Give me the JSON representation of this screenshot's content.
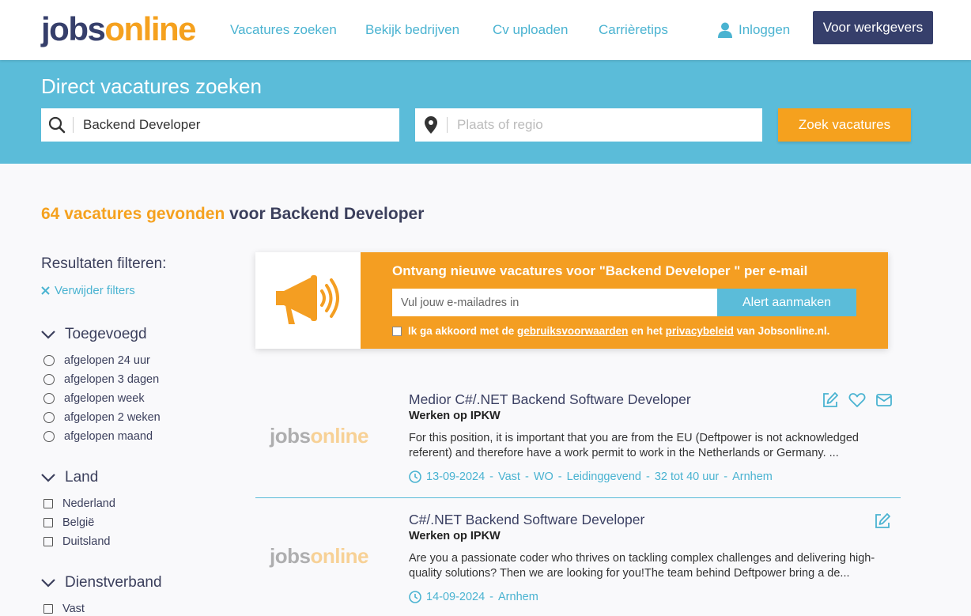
{
  "header": {
    "logo_part1": "jobs",
    "logo_part2": "online",
    "nav": [
      "Vacatures zoeken",
      "Bekijk bedrijven",
      "Cv uploaden",
      "Carrièretips"
    ],
    "login": "Inloggen",
    "employers_button": "Voor werkgevers"
  },
  "search": {
    "title": "Direct vacatures zoeken",
    "keyword_value": "Backend Developer",
    "location_placeholder": "Plaats of regio",
    "button": "Zoek vacatures"
  },
  "results": {
    "count_text": "64 vacatures gevonden",
    "rest_text": " voor Backend Developer"
  },
  "sidebar": {
    "title": "Resultaten filteren:",
    "remove_filters": "Verwijder filters",
    "groups": [
      {
        "name": "Toegevoegd",
        "options": [
          "afgelopen 24 uur",
          "afgelopen 3 dagen",
          "afgelopen week",
          "afgelopen 2 weken",
          "afgelopen maand"
        ]
      },
      {
        "name": "Land",
        "options": [
          "Nederland",
          "België",
          "Duitsland"
        ]
      },
      {
        "name": "Dienstverband",
        "options": [
          "Vast"
        ]
      }
    ]
  },
  "alert": {
    "title": "Ontvang nieuwe vacatures voor \"Backend Developer \" per e-mail",
    "email_placeholder": "Vul jouw e-mailadres in",
    "button": "Alert aanmaken",
    "agree_prefix": "Ik ga akkoord met de ",
    "terms_link": "gebruiksvoorwaarden",
    "agree_middle": " en het ",
    "privacy_link": "privacybeleid",
    "agree_suffix": " van Jobsonline.nl."
  },
  "jobs": [
    {
      "logo_part1": "jobs",
      "logo_part2": "online",
      "title": "Medior C#/.NET Backend Software Developer",
      "company": "Werken op IPKW",
      "description": "For this position, it is important that you are from the EU (Deftpower is not acknowledged referent) and therefore have a work permit to work in the Netherlands or Germany. ...",
      "meta": [
        "13-09-2024",
        "Vast",
        "WO",
        "Leidinggevend",
        "32 tot 40 uur",
        "Arnhem"
      ]
    },
    {
      "logo_part1": "jobs",
      "logo_part2": "online",
      "title": "C#/.NET Backend Software Developer",
      "company": "Werken op IPKW",
      "description": "Are you a passionate coder who thrives on tackling complex challenges and delivering high-quality solutions? Then we are looking for you!The team behind Deftpower bring a de...",
      "meta": [
        "14-09-2024",
        "Arnhem"
      ]
    }
  ],
  "meta_separator": "-",
  "colors": {
    "brand_dark": "#363f6b",
    "brand_orange": "#f5a11e",
    "brand_blue": "#5bbcd9",
    "link_blue": "#4ab3d1"
  }
}
